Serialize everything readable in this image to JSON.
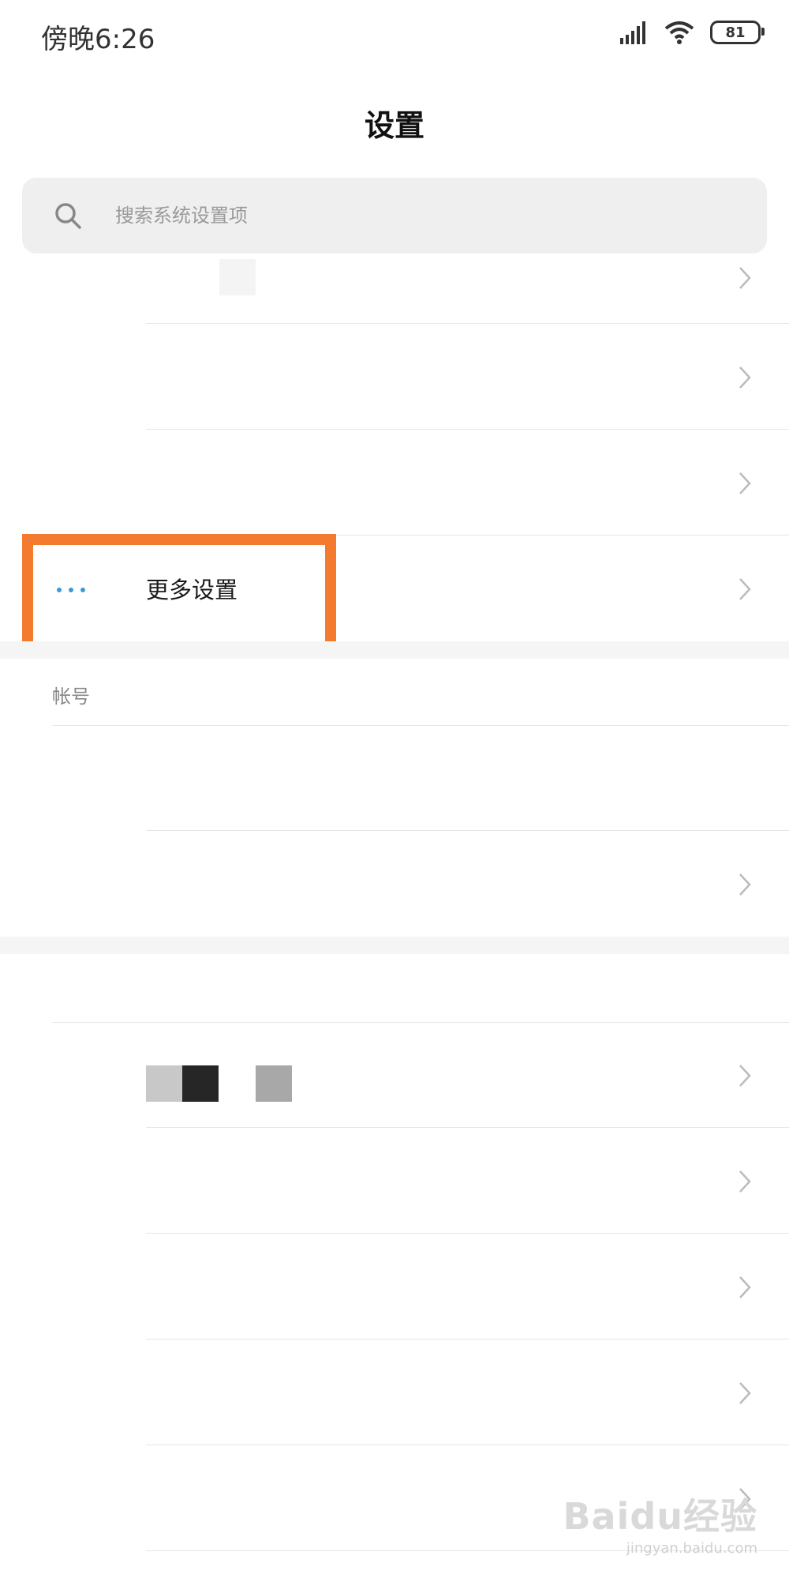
{
  "status_bar": {
    "time": "傍晚6:26",
    "battery": "81"
  },
  "header": {
    "title": "设置"
  },
  "search": {
    "placeholder": "搜索系统设置项"
  },
  "rows": {
    "more_settings_label": "更多设置"
  },
  "sections": {
    "account_label": "帐号"
  },
  "watermark": {
    "brand": "Baidu经验",
    "url": "jingyan.baidu.com"
  },
  "colors": {
    "highlight": "#f47a2f",
    "dots": "#3a9ad9",
    "search_bg": "#efefef"
  }
}
